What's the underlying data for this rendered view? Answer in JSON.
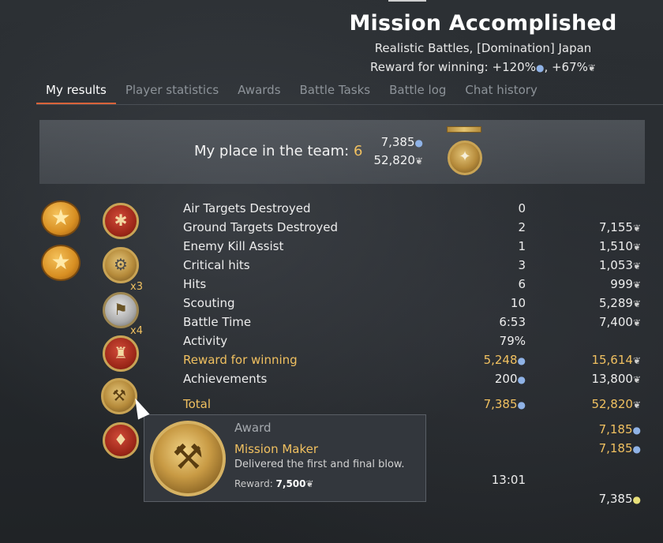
{
  "header": {
    "title": "Mission Accomplished",
    "subtitle": "Realistic Battles, [Domination] Japan",
    "reward_prefix": "Reward for winning: +120%",
    "reward_mid": ", +67%"
  },
  "tabs": [
    {
      "label": "My results",
      "active": true
    },
    {
      "label": "Player statistics"
    },
    {
      "label": "Awards"
    },
    {
      "label": "Battle Tasks"
    },
    {
      "label": "Battle log"
    },
    {
      "label": "Chat history"
    }
  ],
  "place": {
    "label": "My place in the team: ",
    "value": "6",
    "research_points": "7,385",
    "silver_lions": "52,820"
  },
  "awards": {
    "multiplier_a": "x3",
    "multiplier_b": "x4"
  },
  "stats": [
    {
      "label": "Air Targets Destroyed",
      "col1": "0",
      "col2": ""
    },
    {
      "label": "Ground Targets Destroyed",
      "col1": "2",
      "col2": "7,155"
    },
    {
      "label": "Enemy Kill Assist",
      "col1": "1",
      "col2": "1,510"
    },
    {
      "label": "Critical hits",
      "col1": "3",
      "col2": "1,053"
    },
    {
      "label": "Hits",
      "col1": "6",
      "col2": "999"
    },
    {
      "label": "Scouting",
      "col1": "10",
      "col2": "5,289"
    },
    {
      "label": "Battle Time",
      "col1": "6:53",
      "col2": "7,400"
    },
    {
      "label": "Activity",
      "col1": "79%",
      "col2": ""
    },
    {
      "label": "Reward for winning",
      "col1": "5,248",
      "col2": "15,614"
    },
    {
      "label": "Achievements",
      "col1": "200",
      "col2": "13,800"
    },
    {
      "label": "Total",
      "col1": "7,385",
      "col2": "52,820"
    }
  ],
  "extra": {
    "rp_a": "7,185",
    "rp_b": "7,185",
    "time": "13:01",
    "final_value": "7,385"
  },
  "tooltip": {
    "category": "Award",
    "name": "Mission Maker",
    "description": "Delivered the first and final blow.",
    "reward_label": "Reward: ",
    "reward_value": "7,500"
  },
  "icons": {
    "research": "drop-icon",
    "silver": "eagle-icon"
  },
  "colors": {
    "accent": "#d9633a",
    "gold": "#f0c060",
    "rp_blue": "#8fb2e6"
  }
}
